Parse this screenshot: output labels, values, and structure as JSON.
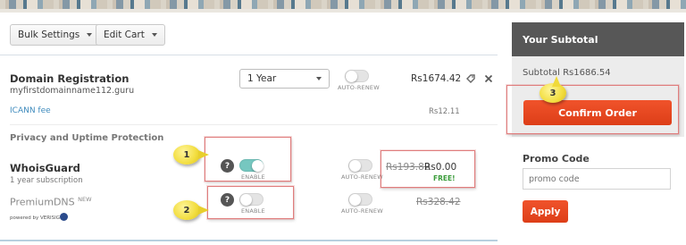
{
  "toolbar": {
    "bulk_settings": "Bulk Settings",
    "edit_cart": "Edit Cart"
  },
  "domain": {
    "title": "Domain Registration",
    "name": "myfirstdomainname112.guru",
    "term": "1 Year",
    "autorenew": "AUTO-RENEW",
    "price": "Rs1674.42",
    "icann_label": "ICANN fee",
    "icann_price": "Rs12.11"
  },
  "privacy": {
    "heading": "Privacy and Uptime Protection",
    "whoisguard": {
      "title": "WhoisGuard",
      "sub": "1 year subscription",
      "enable": "ENABLE",
      "autorenew": "AUTO-RENEW",
      "old_price": "Rs193.82",
      "price": "Rs0.00",
      "free": "FREE!"
    },
    "premiumdns": {
      "title": "PremiumDNS",
      "badge": "NEW",
      "powered": "powered by VERISIGN",
      "enable": "ENABLE",
      "autorenew": "AUTO-RENEW",
      "old_price": "Rs328.42"
    }
  },
  "callouts": {
    "one": "1",
    "two": "2",
    "three": "3"
  },
  "summary": {
    "heading": "Your Subtotal",
    "subtotal": "Subtotal Rs1686.54",
    "confirm": "Confirm Order",
    "promo_heading": "Promo Code",
    "promo_placeholder": "promo code",
    "apply": "Apply"
  },
  "icons": {
    "tag": "tag-icon",
    "close": "close-icon",
    "help": "question-icon",
    "dropdown": "chevron-down-icon"
  },
  "colors": {
    "accent": "#e5491f",
    "toggle_on": "#76c7c0",
    "link": "#3f8bbd",
    "header_dark": "#575757"
  },
  "toggles": {
    "whoisguard_enable": true,
    "premiumdns_enable": false,
    "domain_autorenew": false
  }
}
